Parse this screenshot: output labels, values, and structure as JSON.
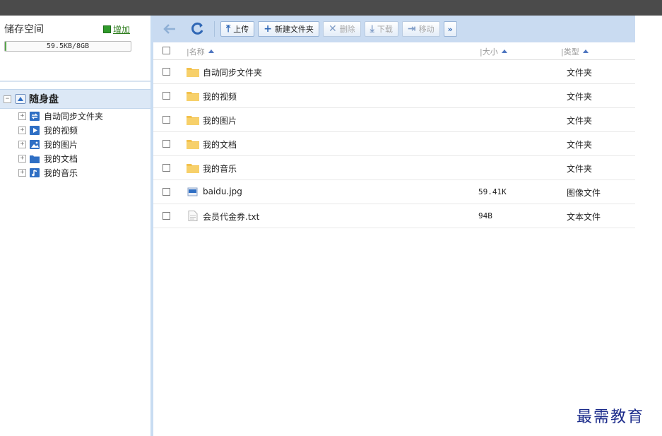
{
  "storage": {
    "title": "储存空间",
    "add_label": "增加",
    "quota_text": "59.5KB/8GB",
    "quota_fraction": 0.01
  },
  "tree": {
    "root_label": "随身盘",
    "items": [
      {
        "label": "自动同步文件夹",
        "icon": "sync-folder-icon",
        "color": "#2f6fc4"
      },
      {
        "label": "我的视频",
        "icon": "video-folder-icon",
        "color": "#2f6fc4"
      },
      {
        "label": "我的图片",
        "icon": "picture-folder-icon",
        "color": "#2f6fc4"
      },
      {
        "label": "我的文档",
        "icon": "document-folder-icon",
        "color": "#2f6fc4"
      },
      {
        "label": "我的音乐",
        "icon": "music-folder-icon",
        "color": "#2f6fc4"
      }
    ]
  },
  "toolbar": {
    "upload": "上传",
    "new_folder": "新建文件夹",
    "delete": "删除",
    "download": "下载",
    "move": "移动"
  },
  "columns": {
    "name": "名称",
    "size": "大小",
    "type": "类型"
  },
  "files": [
    {
      "name": "自动同步文件夹",
      "size": "",
      "type": "文件夹",
      "icon": "folder-icon"
    },
    {
      "name": "我的视频",
      "size": "",
      "type": "文件夹",
      "icon": "folder-icon"
    },
    {
      "name": "我的图片",
      "size": "",
      "type": "文件夹",
      "icon": "folder-icon"
    },
    {
      "name": "我的文档",
      "size": "",
      "type": "文件夹",
      "icon": "folder-icon"
    },
    {
      "name": "我的音乐",
      "size": "",
      "type": "文件夹",
      "icon": "folder-icon"
    },
    {
      "name": "baidu.jpg",
      "size": "59.41K",
      "type": "图像文件",
      "icon": "image-file-icon"
    },
    {
      "name": "会员代金券.txt",
      "size": "94B",
      "type": "文本文件",
      "icon": "text-file-icon"
    }
  ],
  "watermark": "最需教育",
  "colors": {
    "accent": "#c9dbf1",
    "folder": "#f3c14b",
    "link": "#2f7d1e"
  }
}
